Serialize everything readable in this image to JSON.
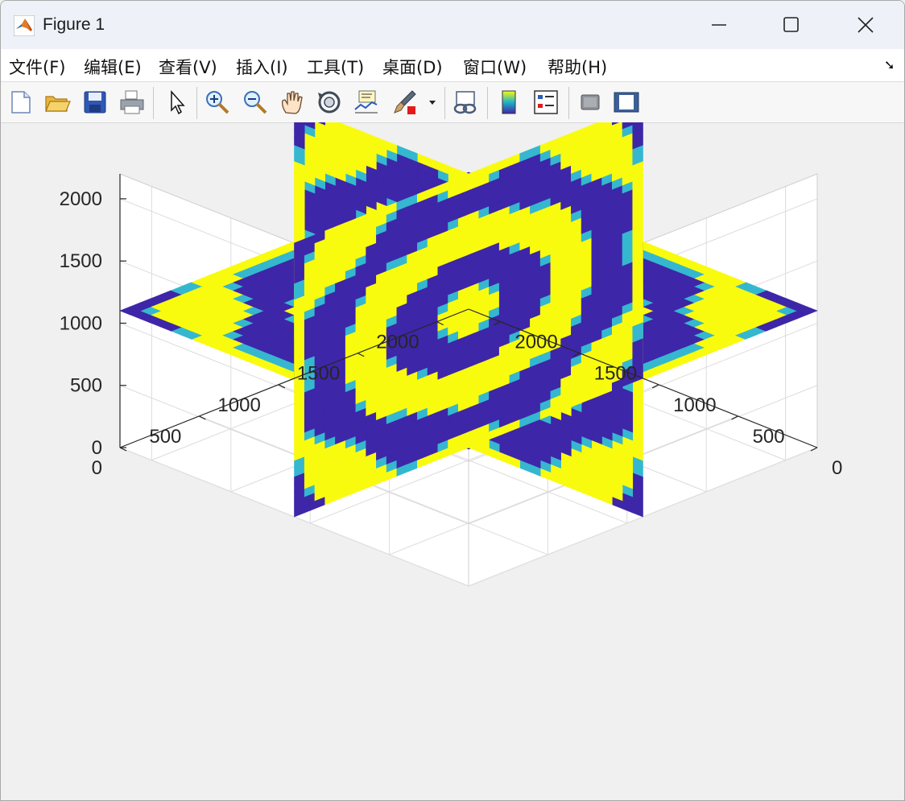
{
  "window": {
    "title": "Figure 1",
    "controls": {
      "minimize": "minimize",
      "maximize": "maximize",
      "close": "close"
    }
  },
  "menubar": {
    "items": [
      {
        "label": "文件(F)",
        "x": 10
      },
      {
        "label": "编辑(E)",
        "x": 103
      },
      {
        "label": "查看(V)",
        "x": 196
      },
      {
        "label": "插入(I)",
        "x": 292
      },
      {
        "label": "工具(T)",
        "x": 380
      },
      {
        "label": "桌面(D)",
        "x": 474
      },
      {
        "label": "窗口(W)",
        "x": 574
      },
      {
        "label": "帮助(H)",
        "x": 679
      }
    ]
  },
  "toolbar": {
    "buttons": [
      {
        "name": "new-figure-icon"
      },
      {
        "name": "open-file-icon"
      },
      {
        "name": "save-icon"
      },
      {
        "name": "print-icon"
      },
      {
        "name": "pointer-icon"
      },
      {
        "name": "zoom-in-icon"
      },
      {
        "name": "zoom-out-icon"
      },
      {
        "name": "pan-hand-icon"
      },
      {
        "name": "rotate-3d-icon"
      },
      {
        "name": "data-cursor-icon"
      },
      {
        "name": "brush-icon"
      },
      {
        "name": "link-plot-icon"
      },
      {
        "name": "colorbar-icon"
      },
      {
        "name": "legend-icon"
      },
      {
        "name": "hide-plot-tools-icon"
      },
      {
        "name": "show-plot-tools-icon"
      }
    ]
  },
  "chart_data": {
    "type": "slice3d",
    "title": "",
    "xlabel": "",
    "ylabel": "",
    "zlabel": "",
    "x_ticks": [
      "0",
      "500",
      "1000",
      "1500",
      "2000"
    ],
    "y_ticks": [
      "0",
      "500",
      "1000",
      "1500",
      "2000"
    ],
    "z_ticks": [
      "0",
      "500",
      "1000",
      "1500",
      "2000"
    ],
    "slices": [
      "x-plane",
      "y-plane",
      "z-plane"
    ],
    "colormap": [
      "#3e26a8",
      "#1fb2c8",
      "#f9fb0e"
    ],
    "grid": true
  },
  "colors": {
    "dark": "#3e26a8",
    "light": "#f9fb0e",
    "edge": "#35b7d0"
  }
}
